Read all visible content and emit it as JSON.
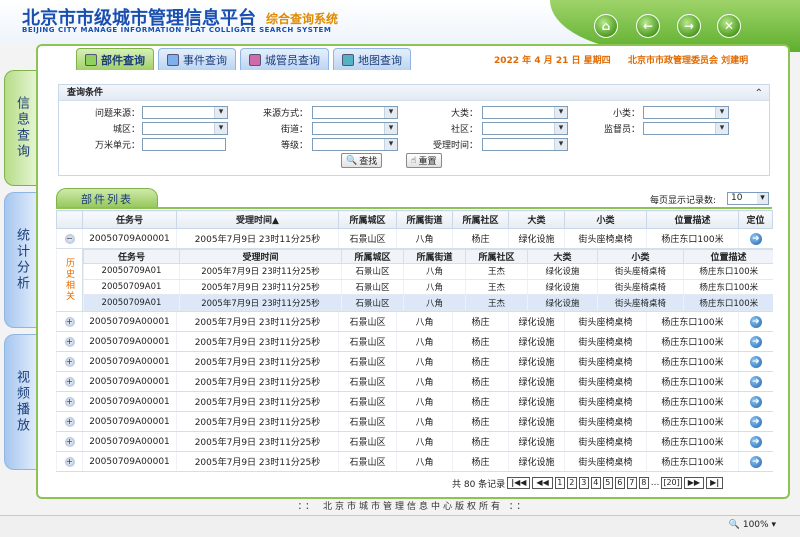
{
  "header": {
    "title": "北京市市级城市管理信息平台",
    "subtitle": "综合查询系统",
    "en_title": "BEIJING CITY MANAGE INFORMATION PLAT COLLIGATE SEARCH SYSTEM",
    "nav_buttons": [
      {
        "icon": "home-icon",
        "glyph": "⌂"
      },
      {
        "icon": "back-icon",
        "glyph": "←"
      },
      {
        "icon": "forward-icon",
        "glyph": "→"
      },
      {
        "icon": "close-icon",
        "glyph": "✕"
      }
    ]
  },
  "left_tabs": [
    {
      "label": "信息查询",
      "active": true
    },
    {
      "label": "统计分析",
      "active": false
    },
    {
      "label": "视频播放",
      "active": false
    }
  ],
  "tabs": [
    {
      "label": "部件查询",
      "icon": "component-icon",
      "active": true
    },
    {
      "label": "事件查询",
      "icon": "event-icon",
      "active": false
    },
    {
      "label": "城管员查询",
      "icon": "officer-icon",
      "active": false
    },
    {
      "label": "地图查询",
      "icon": "map-icon",
      "active": false
    }
  ],
  "date_text": "2022 年 4 月 21 日 星期四",
  "org_text": "北京市市政管理委员会 刘建明",
  "query": {
    "title": "查询条件",
    "fields": {
      "source": "问题来源：",
      "source_method": "来源方式：",
      "category_major": "大类：",
      "category_minor": "小类：",
      "district": "城区：",
      "street": "街道：",
      "community": "社区：",
      "supervisor": "监督员：",
      "grid_unit": "万米单元：",
      "level": "等级：",
      "accept_time": "受理时间："
    },
    "search_button": "查找",
    "reset_button": "重置"
  },
  "list": {
    "tab_label": "部件列表",
    "per_page_label": "每页显示记录数:",
    "per_page_value": "10",
    "columns": [
      "任务号",
      "受理时间▲",
      "所属城区",
      "所属街道",
      "所属社区",
      "大类",
      "小类",
      "位置描述",
      "定位"
    ],
    "first_row": {
      "id": "20050709A00001",
      "time": "2005年7月9日  23时11分25秒",
      "district": "石景山区",
      "street": "八角",
      "community": "杨庄",
      "major": "绿化设施",
      "minor": "街头座椅桌椅",
      "location": "杨庄东口100米"
    },
    "history": {
      "side_label": "历史相关",
      "columns": [
        "任务号",
        "受理时间",
        "所属城区",
        "所属街道",
        "所属社区",
        "大类",
        "小类",
        "位置描述"
      ],
      "rows": [
        {
          "id": "20050709A01",
          "time": "2005年7月9日  23时11分25秒",
          "district": "石景山区",
          "street": "八角",
          "community": "王杰",
          "major": "绿化设施",
          "minor": "街头座椅桌椅",
          "location": "杨庄东口100米"
        },
        {
          "id": "20050709A01",
          "time": "2005年7月9日  23时11分25秒",
          "district": "石景山区",
          "street": "八角",
          "community": "王杰",
          "major": "绿化设施",
          "minor": "街头座椅桌椅",
          "location": "杨庄东口100米"
        },
        {
          "id": "20050709A01",
          "time": "2005年7月9日  23时11分25秒",
          "district": "石景山区",
          "street": "八角",
          "community": "王杰",
          "major": "绿化设施",
          "minor": "街头座椅桌椅",
          "location": "杨庄东口100米"
        }
      ]
    },
    "rows": [
      {
        "id": "20050709A00001",
        "time": "2005年7月9日  23时11分25秒",
        "district": "石景山区",
        "street": "八角",
        "community": "杨庄",
        "major": "绿化设施",
        "minor": "街头座椅桌椅",
        "location": "杨庄东口100米"
      },
      {
        "id": "20050709A00001",
        "time": "2005年7月9日  23时11分25秒",
        "district": "石景山区",
        "street": "八角",
        "community": "杨庄",
        "major": "绿化设施",
        "minor": "街头座椅桌椅",
        "location": "杨庄东口100米"
      },
      {
        "id": "20050709A00001",
        "time": "2005年7月9日  23时11分25秒",
        "district": "石景山区",
        "street": "八角",
        "community": "杨庄",
        "major": "绿化设施",
        "minor": "街头座椅桌椅",
        "location": "杨庄东口100米"
      },
      {
        "id": "20050709A00001",
        "time": "2005年7月9日  23时11分25秒",
        "district": "石景山区",
        "street": "八角",
        "community": "杨庄",
        "major": "绿化设施",
        "minor": "街头座椅桌椅",
        "location": "杨庄东口100米"
      },
      {
        "id": "20050709A00001",
        "time": "2005年7月9日  23时11分25秒",
        "district": "石景山区",
        "street": "八角",
        "community": "杨庄",
        "major": "绿化设施",
        "minor": "街头座椅桌椅",
        "location": "杨庄东口100米"
      },
      {
        "id": "20050709A00001",
        "time": "2005年7月9日  23时11分25秒",
        "district": "石景山区",
        "street": "八角",
        "community": "杨庄",
        "major": "绿化设施",
        "minor": "街头座椅桌椅",
        "location": "杨庄东口100米"
      },
      {
        "id": "20050709A00001",
        "time": "2005年7月9日  23时11分25秒",
        "district": "石景山区",
        "street": "八角",
        "community": "杨庄",
        "major": "绿化设施",
        "minor": "街头座椅桌椅",
        "location": "杨庄东口100米"
      },
      {
        "id": "20050709A00001",
        "time": "2005年7月9日  23时11分25秒",
        "district": "石景山区",
        "street": "八角",
        "community": "杨庄",
        "major": "绿化设施",
        "minor": "街头座椅桌椅",
        "location": "杨庄东口100米"
      }
    ]
  },
  "pager": {
    "total_text": "共 80 条记录",
    "first": "|◀◀",
    "prev": "◀◀",
    "pages": [
      "1",
      "2",
      "3",
      "4",
      "5",
      "6",
      "7",
      "8"
    ],
    "ellipsis": "...",
    "last_page": "[20]",
    "next": "▶▶",
    "last": "▶|"
  },
  "footer": "：：  北京市城市管理信息中心版权所有  ：：",
  "status": {
    "zoom": "100%"
  },
  "colors": {
    "brand_blue": "#1a4fb0",
    "accent_orange": "#e08b00",
    "frame_green": "#8cc453"
  }
}
